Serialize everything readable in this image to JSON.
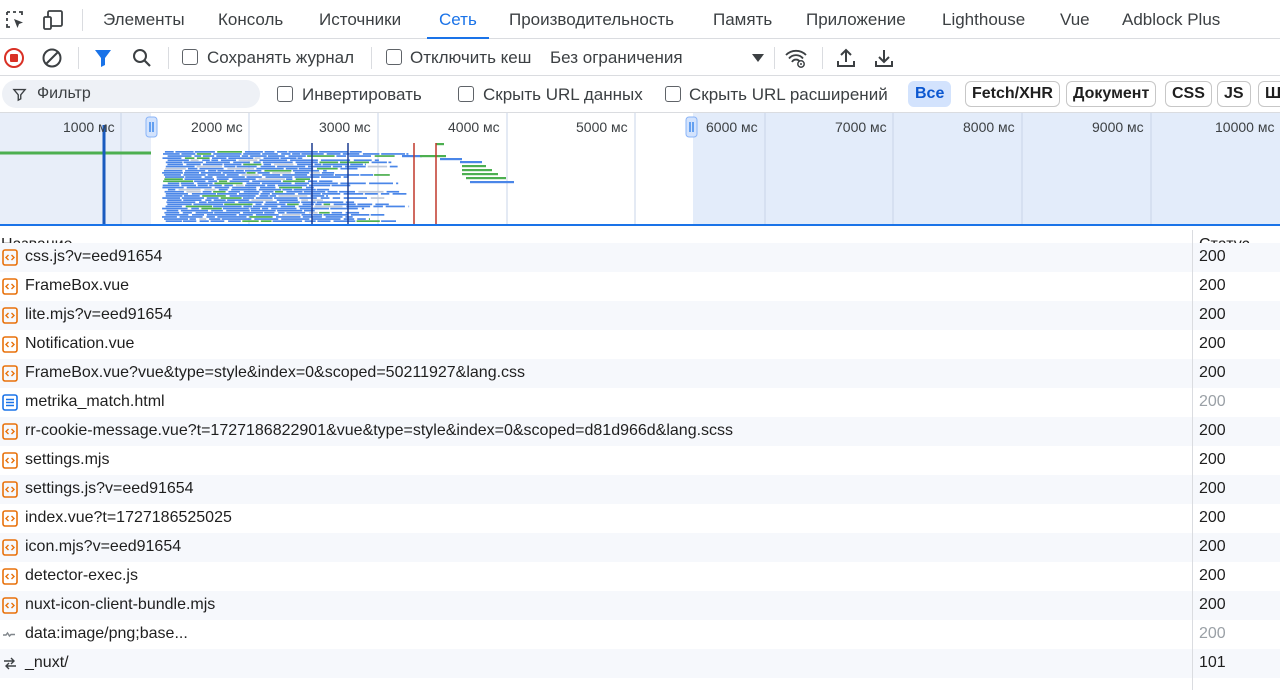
{
  "tabs": [
    {
      "label": "Элементы",
      "active": false
    },
    {
      "label": "Консоль",
      "active": false
    },
    {
      "label": "Источники",
      "active": false
    },
    {
      "label": "Сеть",
      "active": true
    },
    {
      "label": "Производительность",
      "active": false
    },
    {
      "label": "Память",
      "active": false
    },
    {
      "label": "Приложение",
      "active": false
    },
    {
      "label": "Lighthouse",
      "active": false
    },
    {
      "label": "Vue",
      "active": false
    },
    {
      "label": "Adblock Plus",
      "active": false
    }
  ],
  "toolbar": {
    "preserve_log_label": "Сохранять журнал",
    "disable_cache_label": "Отключить кеш",
    "throttling_value": "Без ограничения"
  },
  "filterbar": {
    "filter_placeholder": "Фильтр",
    "invert_label": "Инвертировать",
    "hide_data_urls_label": "Скрыть URL данных",
    "hide_ext_urls_label": "Скрыть URL расширений",
    "types": [
      {
        "label": "Все",
        "active": true
      },
      {
        "label": "Fetch/XHR",
        "active": false
      },
      {
        "label": "Документ",
        "active": false
      },
      {
        "label": "CSS",
        "active": false
      },
      {
        "label": "JS",
        "active": false
      },
      {
        "label": "Ш",
        "active": false
      }
    ]
  },
  "overview": {
    "ticks": [
      "1000 мс",
      "2000 мс",
      "3000 мс",
      "4000 мс",
      "5000 мс",
      "6000 мс",
      "7000 мс",
      "8000 мс",
      "9000 мс",
      "10000 мс"
    ]
  },
  "table": {
    "headers": {
      "name": "Название",
      "status": "Статус"
    },
    "rows": [
      {
        "name": "css.js?v=eed91654",
        "status": "200",
        "icon": "script-icon",
        "dim": false
      },
      {
        "name": "FrameBox.vue",
        "status": "200",
        "icon": "script-icon",
        "dim": false
      },
      {
        "name": "lite.mjs?v=eed91654",
        "status": "200",
        "icon": "script-icon",
        "dim": false
      },
      {
        "name": "Notification.vue",
        "status": "200",
        "icon": "script-icon",
        "dim": false
      },
      {
        "name": "FrameBox.vue?vue&type=style&index=0&scoped=50211927&lang.css",
        "status": "200",
        "icon": "script-icon",
        "dim": false
      },
      {
        "name": "metrika_match.html",
        "status": "200",
        "icon": "document-icon",
        "dim": true
      },
      {
        "name": "rr-cookie-message.vue?t=1727186822901&vue&type=style&index=0&scoped=d81d966d&lang.scss",
        "status": "200",
        "icon": "script-icon",
        "dim": false
      },
      {
        "name": "settings.mjs",
        "status": "200",
        "icon": "script-icon",
        "dim": false
      },
      {
        "name": "settings.js?v=eed91654",
        "status": "200",
        "icon": "script-icon",
        "dim": false
      },
      {
        "name": "index.vue?t=1727186525025",
        "status": "200",
        "icon": "script-icon",
        "dim": false
      },
      {
        "name": "icon.mjs?v=eed91654",
        "status": "200",
        "icon": "script-icon",
        "dim": false
      },
      {
        "name": "detector-exec.js",
        "status": "200",
        "icon": "script-icon",
        "dim": false
      },
      {
        "name": "nuxt-icon-client-bundle.mjs",
        "status": "200",
        "icon": "script-icon",
        "dim": false
      },
      {
        "name": "data:image/png;base...",
        "status": "200",
        "icon": "image-icon",
        "dim": true
      },
      {
        "name": "_nuxt/",
        "status": "101",
        "icon": "websocket-icon",
        "dim": false
      }
    ]
  },
  "colors": {
    "accent": "#1a73e8",
    "record_red": "#d93025",
    "script_orange": "#e8710a",
    "doc_blue": "#1a73e8"
  }
}
